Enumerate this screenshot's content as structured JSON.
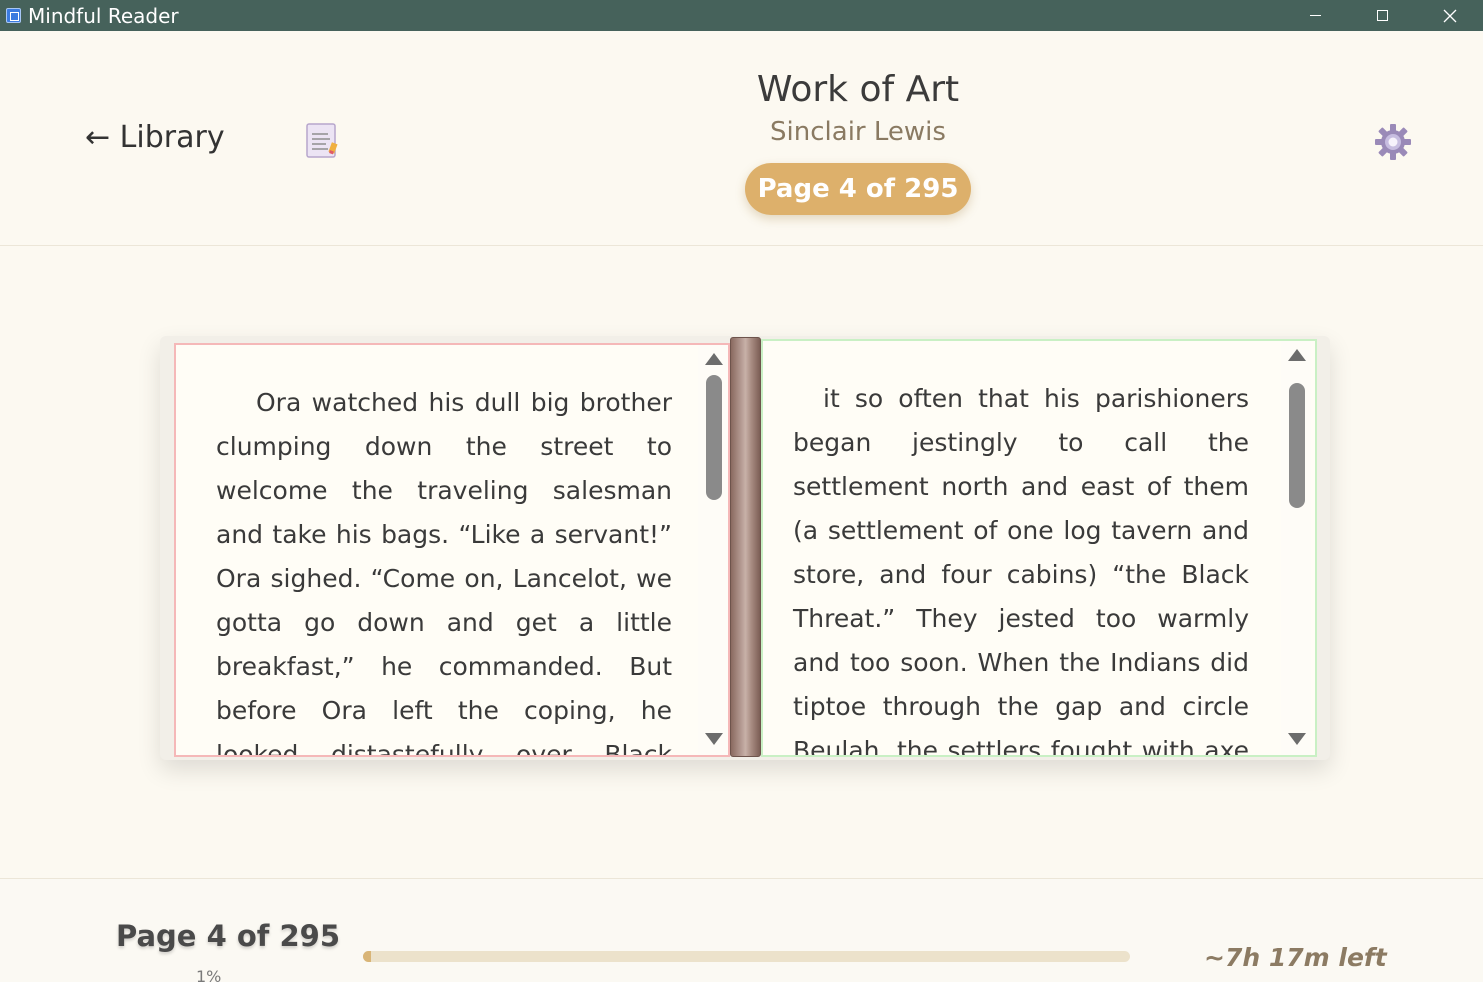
{
  "window": {
    "title": "Mindful Reader"
  },
  "header": {
    "back_label": "← Library",
    "book_title": "Work of Art",
    "book_author": "Sinclair Lewis",
    "page_pill": "Page 4 of 295",
    "icons": {
      "notes": "notes-icon",
      "settings": "gear-icon"
    }
  },
  "pages": {
    "left_text": "Ora watched his dull big brother clumping down the street to welcome the traveling salesman and take his bags. “Like a servant!” Ora sighed. “Come on, Lancelot, we gotta go down and get a little breakfast,” he commanded. But before Ora left the coping, he looked distastefully over Black Thread Center and found",
    "right_text": "it so often that his parishioners began jestingly to call the settlement north and east of them (a settlement of one log tavern and store, and four cabins) “the Black Threat.” They jested too warmly and too soon. When the Indians did tiptoe through the gap and circle Beulah, the settlers fought with axe and rifle, led by the"
  },
  "footer": {
    "page_label": "Page 4 of 295",
    "progress_percent": 1,
    "progress_label": "1%",
    "time_left": "~7h 17m left"
  },
  "colors": {
    "titlebar": "#46625b",
    "accent": "#ddb06b",
    "progress_fill": "#d9b577",
    "left_page_border": "#f5b8b8",
    "right_page_border": "#c9f0c4"
  }
}
